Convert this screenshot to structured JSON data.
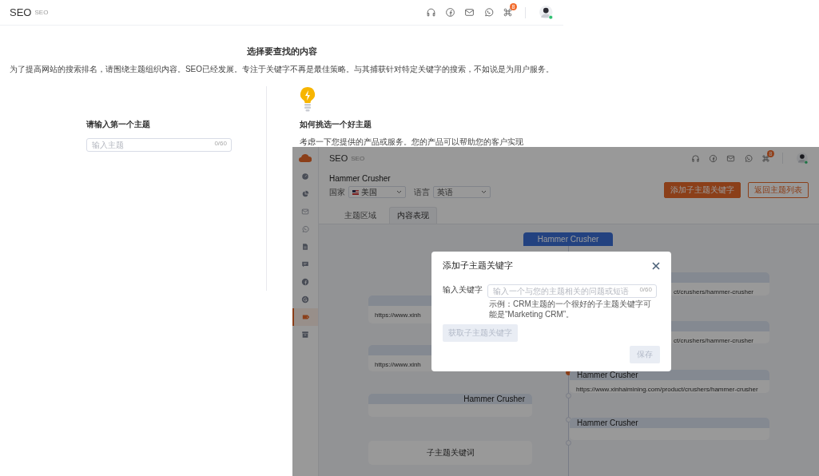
{
  "header": {
    "title": "SEO",
    "subtitle": "SEO",
    "badge": "8"
  },
  "intro": {
    "title": "选择要查找的内容",
    "description": "为了提高网站的搜索排名，请围绕主题组织内容。SEO已经发展。专注于关键字不再是最佳策略。与其捕获针对特定关键字的搜索，不如说是为用户服务。"
  },
  "topic_input": {
    "label": "请输入第一个主题",
    "placeholder": "输入主题",
    "counter": "0/60"
  },
  "tips": {
    "title": "如何挑选一个好主题",
    "text": "考虑一下您提供的产品或服务。您的产品可以帮助您的客户实现"
  },
  "inset": {
    "header": {
      "title": "SEO",
      "subtitle": "SEO",
      "badge": "8"
    },
    "sidebar": [
      {
        "selected": false
      },
      {
        "selected": false
      },
      {
        "selected": false
      },
      {
        "selected": false
      },
      {
        "selected": false
      },
      {
        "selected": false
      },
      {
        "selected": false
      },
      {
        "selected": false
      },
      {
        "selected": true
      },
      {
        "selected": false
      }
    ],
    "topic": "Hammer Crusher",
    "filters": [
      {
        "label": "国家",
        "value": "美国",
        "flag": true
      },
      {
        "label": "语言",
        "value": "英语",
        "flag": false
      }
    ],
    "buttons": [
      {
        "label": "添加子主题关键字",
        "kind": "primary"
      },
      {
        "label": "返回主题列表",
        "kind": "outline"
      }
    ],
    "tabs": [
      {
        "label": "主题区域",
        "selected": false
      },
      {
        "label": "内容表现",
        "selected": true
      }
    ],
    "root": "Hammer Crusher",
    "right_cards": [
      {
        "kind": "covered",
        "url": "ct/crushers/hammer-crusher"
      },
      {
        "kind": "covered",
        "url": "ct/crushers/hammer-crusher"
      },
      {
        "kind": "titled",
        "title": "Hammer Crusher",
        "url": "https://www.xinhaimining.com/product/crushers/hammer-crusher"
      },
      {
        "kind": "titled",
        "title": "Hammer Crusher"
      }
    ],
    "left_cards": [
      {
        "kind": "titled",
        "url": "https://www.xinh"
      },
      {
        "kind": "titled",
        "url": "https://www.xinh"
      },
      {
        "kind": "titled",
        "title": "Hammer Crusher"
      },
      {
        "kind": "plain",
        "title": "子主题关键词"
      }
    ],
    "dots": [
      {
        "active": true
      },
      {
        "active": false
      },
      {
        "active": false
      },
      {
        "active": false
      }
    ],
    "dialog": {
      "title": "添加子主题关键字",
      "field_label": "输入关键字",
      "placeholder": "输入一个与您的主题相关的问题或短语",
      "counter": "0/60",
      "hint": "示例：CRM主题的一个很好的子主题关键字可能是“Marketing CRM”。",
      "fetch_button": {
        "label": "获取子主题关键字",
        "disabled": true
      },
      "save_button": {
        "label": "保存",
        "disabled": true
      }
    }
  }
}
